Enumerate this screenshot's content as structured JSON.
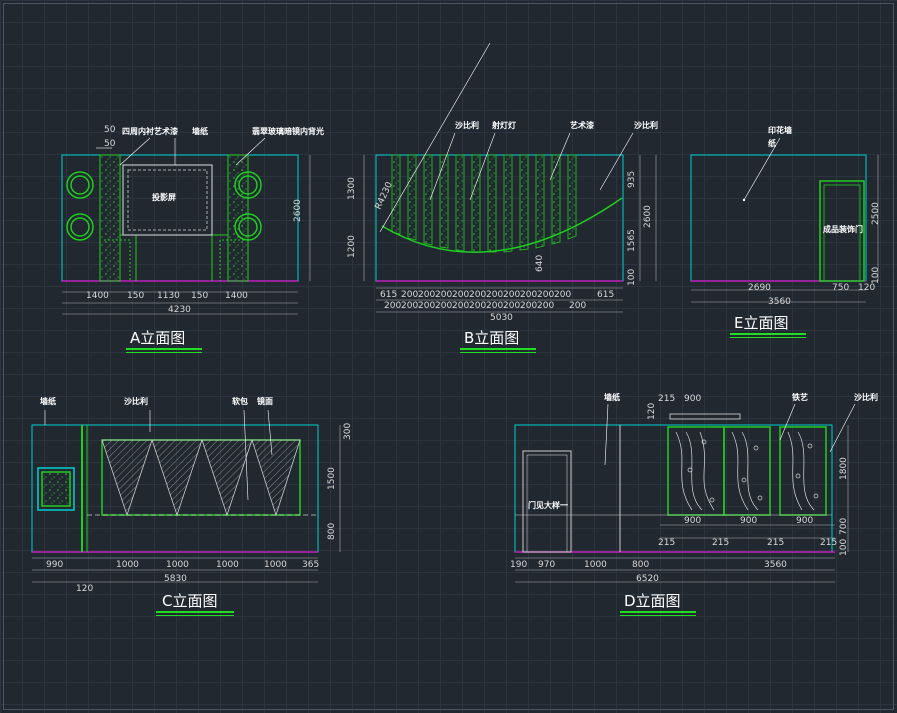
{
  "colors": {
    "background": "#212830",
    "grid": "#2c3440",
    "outline": "#00d0d0",
    "pattern": "#22cc22",
    "floor": "#c020c0",
    "dim_line": "#b0b0b0",
    "title_underline": "#22dd22",
    "text": "#ffffff"
  },
  "elevations": {
    "A": {
      "title": "A立面图",
      "labels": {
        "l1": "四周内衬艺术漆",
        "l2": "墙纸",
        "l3": "翡翠玻璃暗镜内背光",
        "screen": "投影屏"
      },
      "dims_bottom": [
        "1400",
        "150",
        "1130",
        "150",
        "1400"
      ],
      "dim_total": "4230",
      "dim_right": "2600",
      "dim_top": "50",
      "dim_top2": "50"
    },
    "B": {
      "title": "B立面图",
      "labels": {
        "l1": "沙比利",
        "l2": "射灯灯",
        "l3": "艺术漆",
        "l4": "沙比利",
        "radius": "R4230"
      },
      "dims_bottom_1": [
        "615",
        "200",
        "200",
        "200",
        "200",
        "200",
        "200",
        "200",
        "200",
        "200",
        "200",
        "615"
      ],
      "dims_bottom_2": [
        "200",
        "200",
        "200",
        "200",
        "200",
        "200",
        "200",
        "200",
        "200",
        "200",
        "200"
      ],
      "dim_total": "5030",
      "dims_left": [
        "1300",
        "1200"
      ],
      "dims_right": [
        "935",
        "1565"
      ],
      "dim_right_total": "2600",
      "dim_mid": "640",
      "dim_small": "100"
    },
    "E": {
      "title": "E立面图",
      "labels": {
        "l1": "印花墙",
        "l2": "纸",
        "door": "成品装饰门"
      },
      "dims_bottom": [
        "2690",
        "750",
        "120"
      ],
      "dim_total": "3560",
      "dim_right": "2500",
      "dim_small": "100"
    },
    "C": {
      "title": "C立面图",
      "labels": {
        "l1": "墙纸",
        "l2": "沙比利",
        "l3": "软包",
        "l4": "镜面"
      },
      "dims_bottom": [
        "990",
        "1000",
        "1000",
        "1000",
        "1000",
        "365"
      ],
      "dim_total": "5830",
      "dim_small": "120",
      "dims_right": [
        "300",
        "1500",
        "800"
      ]
    },
    "D": {
      "title": "D立面图",
      "labels": {
        "l1": "墙纸",
        "l2": "铁艺",
        "l3": "沙比利",
        "door": "门见大样一"
      },
      "dims_top": [
        "215",
        "900",
        "120"
      ],
      "dims_panels": [
        "900",
        "900",
        "900"
      ],
      "dims_gaps": [
        "215",
        "215",
        "215",
        "215"
      ],
      "dims_bottom": [
        "190",
        "970",
        "1000",
        "800",
        "3560"
      ],
      "dim_total": "6520",
      "dims_right": [
        "1800",
        "700",
        "100"
      ]
    }
  }
}
